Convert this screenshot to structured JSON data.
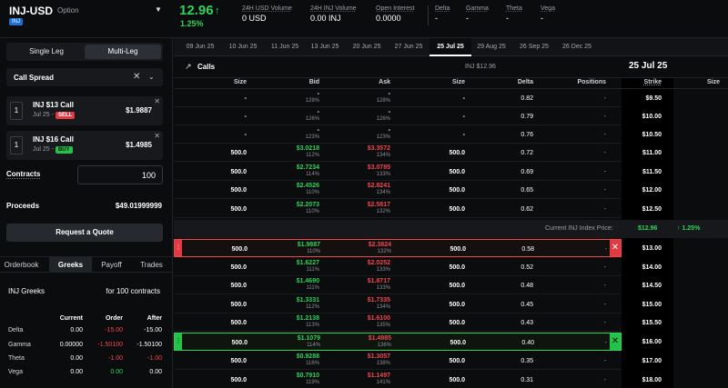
{
  "header": {
    "symbol": "INJ-USD",
    "type": "Option",
    "badge": "INJ",
    "price": "12.96",
    "price_change": "1.25%",
    "stats": [
      {
        "label": "24H USD Volume",
        "value": "0 USD"
      },
      {
        "label": "24H INJ Volume",
        "value": "0.00 INJ"
      },
      {
        "label": "Open Interest",
        "value": "0.0000"
      },
      {
        "label": "Delta",
        "value": "-"
      },
      {
        "label": "Gamma",
        "value": "-"
      },
      {
        "label": "Theta",
        "value": "-"
      },
      {
        "label": "Vega",
        "value": "-"
      }
    ]
  },
  "left": {
    "single_leg": "Single Leg",
    "multi_leg": "Multi-Leg",
    "strategy": "Call Spread",
    "legs": [
      {
        "qty": "1",
        "name": "INJ $13 Call",
        "expiry": "Jul 25 -",
        "side": "SELL",
        "price": "$1.9887"
      },
      {
        "qty": "1",
        "name": "INJ $16 Call",
        "expiry": "Jul 25 -",
        "side": "BUY",
        "price": "$1.4985"
      }
    ],
    "contracts_label": "Contracts",
    "contracts_value": "100",
    "proceeds_label": "Proceeds",
    "proceeds_value": "$49.01999999",
    "quote_button": "Request a Quote",
    "tabs": [
      "Orderbook",
      "Greeks",
      "Payoff",
      "Trades"
    ],
    "greeks_title": "INJ Greeks",
    "greeks_contracts": "for 100 contracts",
    "greeks_headers": [
      "Current",
      "Order",
      "After"
    ],
    "greeks_rows": [
      {
        "name": "Delta",
        "current": "0.00",
        "order": "-15.00",
        "after": "-15.00"
      },
      {
        "name": "Gamma",
        "current": "0.00000",
        "order": "-1.50100",
        "after": "-1.50100"
      },
      {
        "name": "Theta",
        "current": "0.00",
        "order": "-1.00",
        "after": "-1.00"
      },
      {
        "name": "Vega",
        "current": "0.00",
        "order": "0.00",
        "after": "0.00"
      }
    ]
  },
  "expiries": [
    "09 Jun 25",
    "10 Jun 25",
    "11 Jun 25",
    "13 Jun 25",
    "20 Jun 25",
    "27 Jun 25",
    "25 Jul 25",
    "29 Aug 25",
    "26 Sep 25",
    "26 Dec 25"
  ],
  "chain": {
    "title": "Calls",
    "index": "INJ $12.96",
    "date": "25 Jul 25",
    "columns": [
      "Size",
      "Bid",
      "Ask",
      "Size",
      "Delta",
      "Positions",
      "Strike",
      "Size"
    ],
    "index_label": "Current INJ Index Price:",
    "index_price": "$12.96",
    "index_change": "1.25%",
    "rows": [
      {
        "size": "-",
        "bid": "-",
        "bid_iv": "128%",
        "ask": "-",
        "ask_iv": "128%",
        "size2": "-",
        "delta": "0.82",
        "pos": "-",
        "strike": "$9.50"
      },
      {
        "size": "-",
        "bid": "-",
        "bid_iv": "126%",
        "ask": "-",
        "ask_iv": "126%",
        "size2": "-",
        "delta": "0.79",
        "pos": "-",
        "strike": "$10.00"
      },
      {
        "size": "-",
        "bid": "-",
        "bid_iv": "123%",
        "ask": "-",
        "ask_iv": "123%",
        "size2": "-",
        "delta": "0.76",
        "pos": "-",
        "strike": "$10.50"
      },
      {
        "size": "500.0",
        "bid": "$3.0218",
        "bid_iv": "112%",
        "ask": "$3.3572",
        "ask_iv": "134%",
        "size2": "500.0",
        "delta": "0.72",
        "pos": "-",
        "strike": "$11.00"
      },
      {
        "size": "500.0",
        "bid": "$2.7234",
        "bid_iv": "114%",
        "ask": "$3.0785",
        "ask_iv": "133%",
        "size2": "500.0",
        "delta": "0.69",
        "pos": "-",
        "strike": "$11.50"
      },
      {
        "size": "500.0",
        "bid": "$2.4526",
        "bid_iv": "110%",
        "ask": "$2.8241",
        "ask_iv": "134%",
        "size2": "500.0",
        "delta": "0.65",
        "pos": "-",
        "strike": "$12.00"
      },
      {
        "size": "500.0",
        "bid": "$2.2073",
        "bid_iv": "110%",
        "ask": "$2.5817",
        "ask_iv": "132%",
        "size2": "500.0",
        "delta": "0.62",
        "pos": "-",
        "strike": "$12.50"
      },
      {
        "size": "500.0",
        "bid": "$1.9887",
        "bid_iv": "110%",
        "ask": "$2.3824",
        "ask_iv": "132%",
        "size2": "500.0",
        "delta": "0.58",
        "pos": "-",
        "strike": "$13.00"
      },
      {
        "size": "500.0",
        "bid": "$1.6227",
        "bid_iv": "111%",
        "ask": "$2.0252",
        "ask_iv": "133%",
        "size2": "500.0",
        "delta": "0.52",
        "pos": "-",
        "strike": "$14.00"
      },
      {
        "size": "500.0",
        "bid": "$1.4690",
        "bid_iv": "111%",
        "ask": "$1.8717",
        "ask_iv": "133%",
        "size2": "500.0",
        "delta": "0.48",
        "pos": "-",
        "strike": "$14.50"
      },
      {
        "size": "500.0",
        "bid": "$1.3331",
        "bid_iv": "112%",
        "ask": "$1.7335",
        "ask_iv": "134%",
        "size2": "500.0",
        "delta": "0.45",
        "pos": "-",
        "strike": "$15.00"
      },
      {
        "size": "500.0",
        "bid": "$1.2138",
        "bid_iv": "113%",
        "ask": "$1.6100",
        "ask_iv": "135%",
        "size2": "500.0",
        "delta": "0.43",
        "pos": "-",
        "strike": "$15.50"
      },
      {
        "size": "500.0",
        "bid": "$1.1079",
        "bid_iv": "114%",
        "ask": "$1.4985",
        "ask_iv": "136%",
        "size2": "500.0",
        "delta": "0.40",
        "pos": "-",
        "strike": "$16.00"
      },
      {
        "size": "500.0",
        "bid": "$0.9288",
        "bid_iv": "116%",
        "ask": "$1.3057",
        "ask_iv": "138%",
        "size2": "500.0",
        "delta": "0.35",
        "pos": "-",
        "strike": "$17.00"
      },
      {
        "size": "500.0",
        "bid": "$0.7910",
        "bid_iv": "119%",
        "ask": "$1.1497",
        "ask_iv": "141%",
        "size2": "500.0",
        "delta": "0.31",
        "pos": "-",
        "strike": "$18.00"
      }
    ]
  }
}
